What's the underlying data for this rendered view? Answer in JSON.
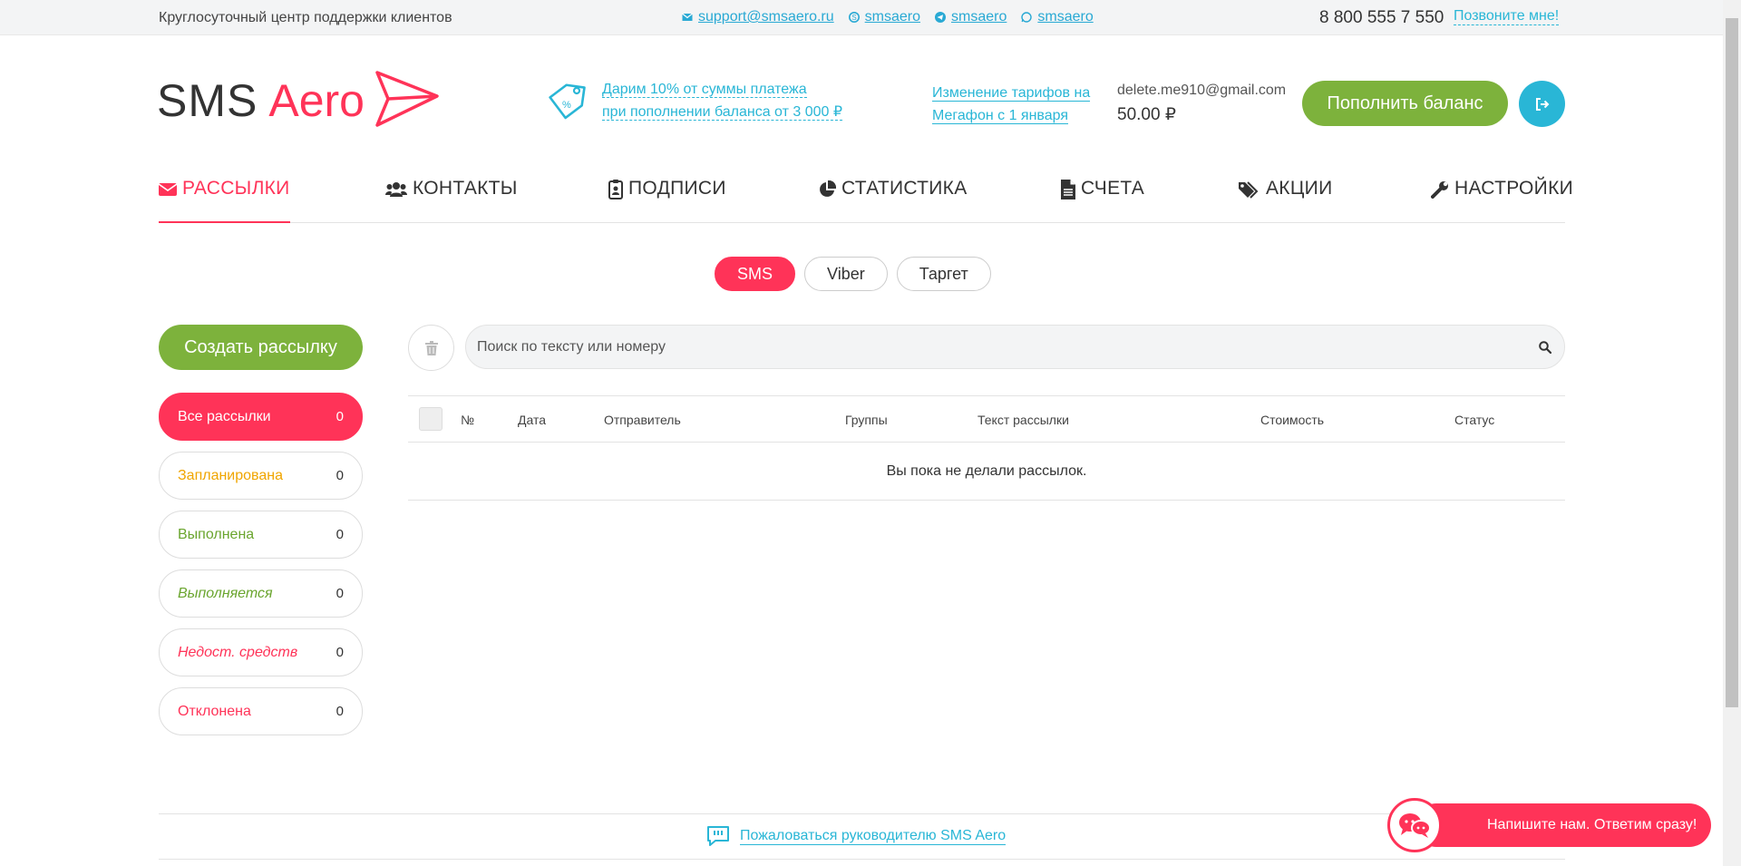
{
  "topbar": {
    "support_text": "Круглосуточный центр поддержки клиентов",
    "email": "support@smsaero.ru",
    "skype": "smsaero",
    "telegram": "smsaero",
    "whatsapp": "smsaero",
    "phone": "8 800 555 7 550",
    "callme": "Позвоните мне!"
  },
  "header": {
    "logo_part1": "SMS",
    "logo_part2": "Aero",
    "promo_line1": "Дарим 10% от суммы платежа",
    "promo_line2": "при пополнении баланса от 3 000 ₽",
    "tariff_line1": "Изменение тарифов на",
    "tariff_line2": "Мегафон с 1 января",
    "account_email": "delete.me910@gmail.com",
    "balance": "50.00 ₽",
    "topup_label": "Пополнить баланс"
  },
  "nav": {
    "items": [
      {
        "label": "РАССЫЛКИ",
        "icon": "envelope-icon"
      },
      {
        "label": "КОНТАКТЫ",
        "icon": "users-icon"
      },
      {
        "label": "ПОДПИСИ",
        "icon": "badge-icon"
      },
      {
        "label": "СТАТИСТИКА",
        "icon": "pie-chart-icon"
      },
      {
        "label": "СЧЕТА",
        "icon": "file-icon"
      },
      {
        "label": "АКЦИИ",
        "icon": "tags-icon"
      },
      {
        "label": "НАСТРОЙКИ",
        "icon": "wrench-icon"
      }
    ]
  },
  "channels": [
    "SMS",
    "Viber",
    "Таргет"
  ],
  "sidebar": {
    "create_label": "Создать рассылку",
    "filters": [
      {
        "label": "Все рассылки",
        "count": "0",
        "color": "#ffffff"
      },
      {
        "label": "Запланирована",
        "count": "0",
        "color": "#f0a500"
      },
      {
        "label": "Выполнена",
        "count": "0",
        "color": "#6aa52e"
      },
      {
        "label": "Выполняется",
        "count": "0",
        "color": "#6aa52e"
      },
      {
        "label": "Недост. средств",
        "count": "0",
        "color": "#ff3358"
      },
      {
        "label": "Отклонена",
        "count": "0",
        "color": "#ff3358"
      }
    ]
  },
  "search": {
    "placeholder": "Поиск по тексту или номеру"
  },
  "table": {
    "columns": [
      "№",
      "Дата",
      "Отправитель",
      "Группы",
      "Текст рассылки",
      "Стоимость",
      "Статус"
    ],
    "empty_text": "Вы пока не делали рассылок."
  },
  "footer": {
    "complaint": "Пожаловаться руководителю SMS Aero"
  },
  "chat": {
    "label": "Напишите нам. Ответим сразу!"
  },
  "colors": {
    "accent_red": "#ff3358",
    "accent_green": "#7db23c",
    "accent_blue": "#29b6d6"
  }
}
